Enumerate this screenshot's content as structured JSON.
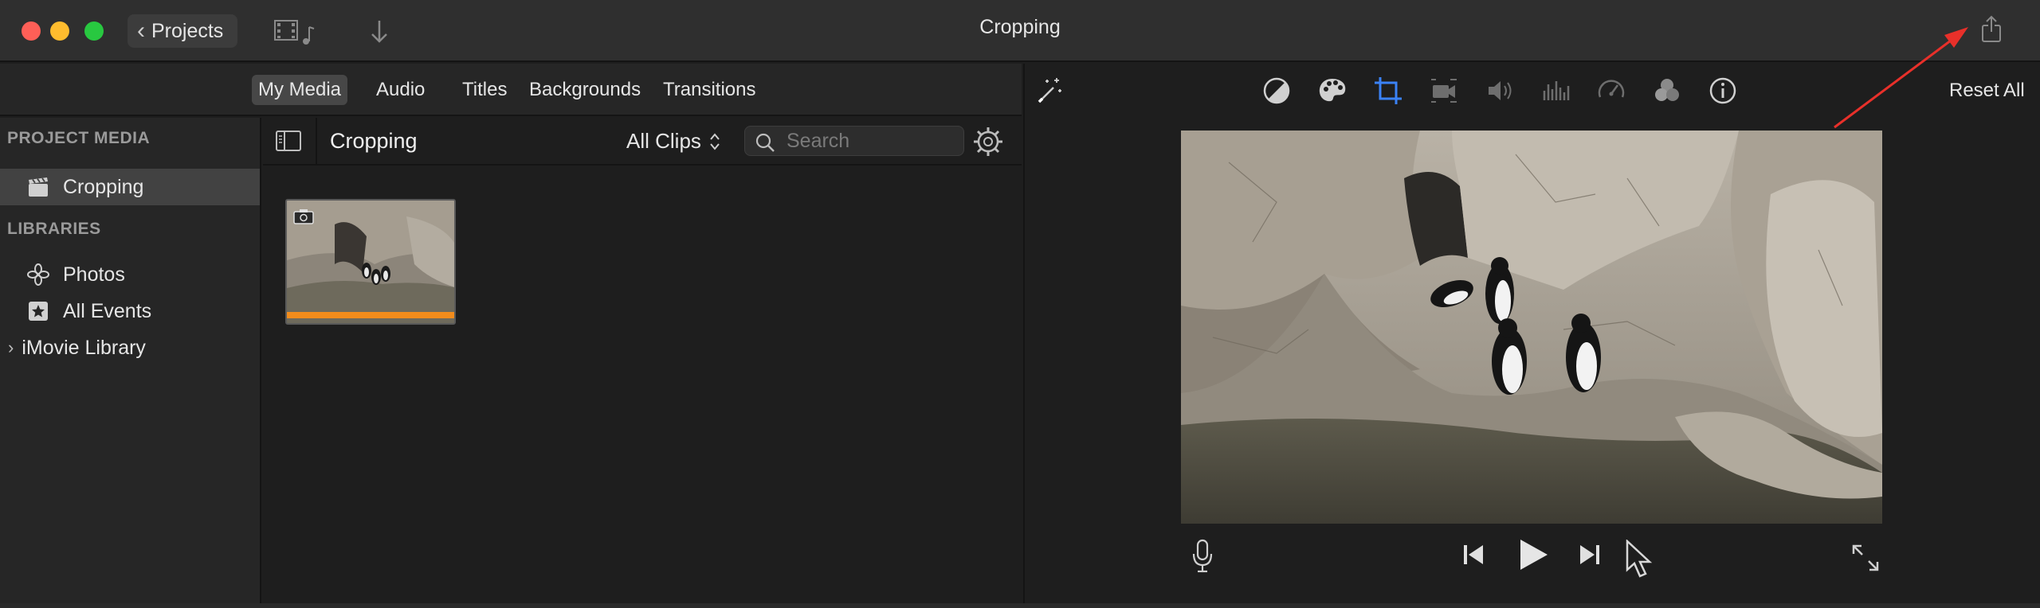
{
  "window": {
    "title": "Cropping",
    "back_button_label": "Projects"
  },
  "browser_tabs": [
    {
      "label": "My Media",
      "active": true
    },
    {
      "label": "Audio",
      "active": false
    },
    {
      "label": "Titles",
      "active": false
    },
    {
      "label": "Backgrounds",
      "active": false
    },
    {
      "label": "Transitions",
      "active": false
    }
  ],
  "sidebar": {
    "project_media_heading": "PROJECT MEDIA",
    "project_item": "Cropping",
    "libraries_heading": "LIBRARIES",
    "photos_item": "Photos",
    "all_events_item": "All Events",
    "library_item": "iMovie Library"
  },
  "browser": {
    "event_title": "Cropping",
    "clips_filter": "All Clips",
    "search_placeholder": "Search"
  },
  "viewer": {
    "reset_label": "Reset All",
    "toolbar_icons": [
      "magic-wand-icon",
      "color-balance-icon",
      "color-correction-icon",
      "crop-icon",
      "stabilization-icon",
      "volume-icon",
      "noise-reduction-icon",
      "speed-icon",
      "clip-filter-icon",
      "info-icon"
    ],
    "active_tool": "crop-icon",
    "accent_color": "#3b82f6"
  },
  "colors": {
    "close": "#fe5f57",
    "minimize": "#febc2e",
    "maximize": "#28c840",
    "clip_bar": "#f28c1c",
    "annotation_arrow": "#e8302a"
  }
}
